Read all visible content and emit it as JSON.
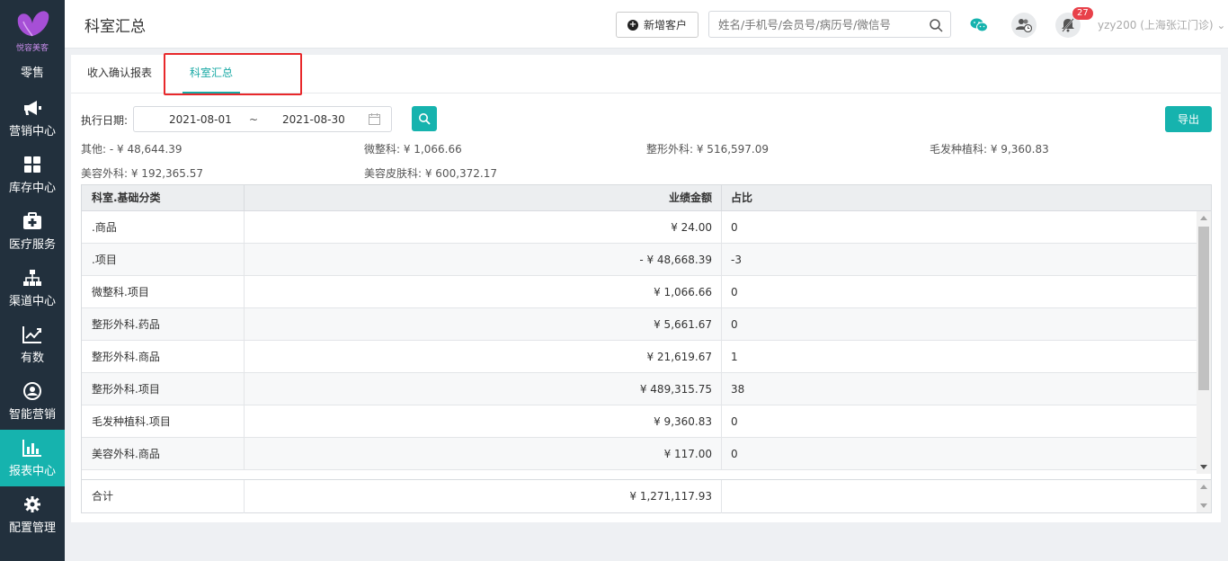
{
  "sidebar": {
    "logo_text": "悦容美客",
    "items": [
      {
        "label": "零售",
        "icon": "retail-icon"
      },
      {
        "label": "营销中心",
        "icon": "megaphone-icon"
      },
      {
        "label": "库存中心",
        "icon": "grid-icon"
      },
      {
        "label": "医疗服务",
        "icon": "medical-kit-icon"
      },
      {
        "label": "渠道中心",
        "icon": "org-chart-icon"
      },
      {
        "label": "有数",
        "icon": "line-chart-icon"
      },
      {
        "label": "智能营销",
        "icon": "smart-marketing-icon"
      },
      {
        "label": "报表中心",
        "icon": "bar-chart-icon",
        "active": true
      },
      {
        "label": "配置管理",
        "icon": "gear-icon"
      }
    ]
  },
  "header": {
    "title": "科室汇总",
    "new_customer_label": "新增客户",
    "search_placeholder": "姓名/手机号/会员号/病历号/微信号",
    "notification_count": "27",
    "user_label": "yzy200 (上海张江门诊)"
  },
  "tabs": [
    {
      "label": "收入确认报表",
      "active": false
    },
    {
      "label": "科室汇总",
      "active": true
    }
  ],
  "filter": {
    "label": "执行日期:",
    "start_date": "2021-08-01",
    "separator": "~",
    "end_date": "2021-08-30",
    "export_label": "导出"
  },
  "summary": [
    {
      "text": "其他: - ¥ 48,644.39"
    },
    {
      "text": "微整科: ¥ 1,066.66"
    },
    {
      "text": "整形外科: ¥ 516,597.09"
    },
    {
      "text": "毛发种植科: ¥ 9,360.83"
    },
    {
      "text": "美容外科: ¥ 192,365.57"
    },
    {
      "text": "美容皮肤科: ¥ 600,372.17"
    }
  ],
  "table": {
    "headers": [
      "科室.基础分类",
      "业绩金额",
      "占比"
    ],
    "rows": [
      {
        "category": ".商品",
        "amount": "¥ 24.00",
        "ratio": "0"
      },
      {
        "category": ".项目",
        "amount": "- ¥ 48,668.39",
        "ratio": "-3"
      },
      {
        "category": "微整科.项目",
        "amount": "¥ 1,066.66",
        "ratio": "0"
      },
      {
        "category": "整形外科.药品",
        "amount": "¥ 5,661.67",
        "ratio": "0"
      },
      {
        "category": "整形外科.商品",
        "amount": "¥ 21,619.67",
        "ratio": "1"
      },
      {
        "category": "整形外科.项目",
        "amount": "¥ 489,315.75",
        "ratio": "38"
      },
      {
        "category": "毛发种植科.项目",
        "amount": "¥ 9,360.83",
        "ratio": "0"
      },
      {
        "category": "美容外科.商品",
        "amount": "¥ 117.00",
        "ratio": "0"
      }
    ],
    "total_label": "合计",
    "total_amount": "¥ 1,271,117.93"
  },
  "colors": {
    "accent": "#16b3ae",
    "sidebar_bg": "#22303d",
    "highlight_frame": "#e8282b",
    "badge": "#e8414a"
  }
}
